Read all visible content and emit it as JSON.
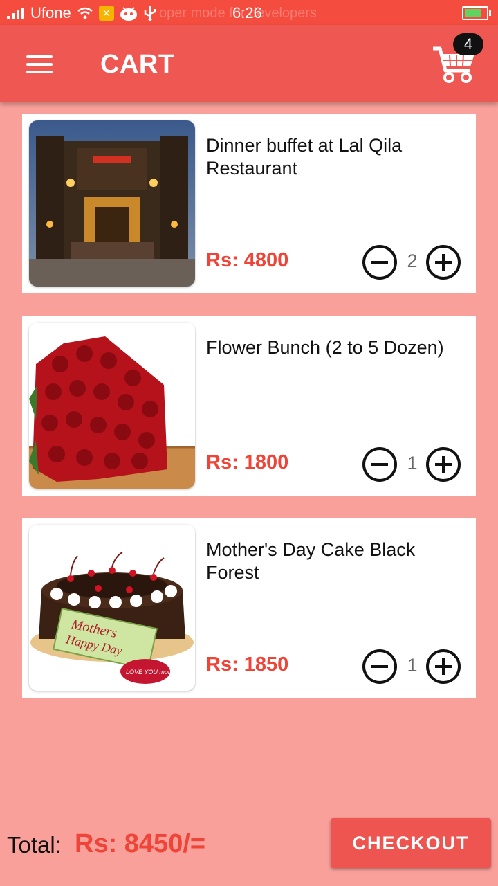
{
  "status_bar": {
    "carrier": "Ufone",
    "time": "6:26",
    "ghost_text": "oper mode for developers"
  },
  "header": {
    "title": "CART",
    "cart_count": "4"
  },
  "items": [
    {
      "name": "Dinner buffet at Lal Qila Restaurant",
      "price": "Rs: 4800",
      "quantity": "2",
      "image_icon": "restaurant-photo"
    },
    {
      "name": "Flower Bunch (2 to 5 Dozen)",
      "price": "Rs: 1800",
      "quantity": "1",
      "image_icon": "roses-photo"
    },
    {
      "name": "Mother's Day Cake Black Forest",
      "price": "Rs: 1850",
      "quantity": "1",
      "image_icon": "cake-photo"
    }
  ],
  "footer": {
    "total_label": "Total:",
    "total_value": "Rs: 8450/=",
    "checkout_label": "CHECKOUT"
  },
  "colors": {
    "accent": "#ef5753",
    "status_bar": "#f44d3f",
    "background": "#f9a09a",
    "price": "#ef4438"
  }
}
